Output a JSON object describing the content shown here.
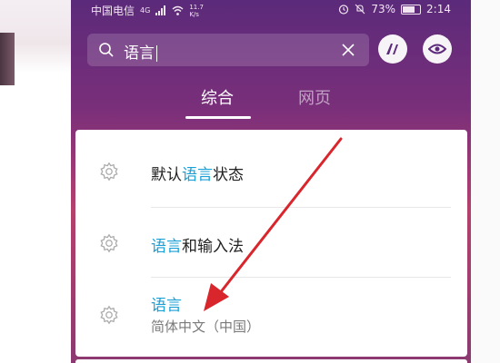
{
  "status_bar": {
    "carrier": "中国电信",
    "network": "4G",
    "speed_value": "11.7",
    "speed_unit": "K/s",
    "battery": "73%",
    "time": "2:14"
  },
  "search": {
    "query": "语言"
  },
  "tabs": [
    {
      "label": "综合",
      "active": true
    },
    {
      "label": "网页",
      "active": false
    }
  ],
  "results": [
    {
      "title_before": "默认",
      "title_highlight": "语言",
      "title_after": "状态",
      "subtitle": ""
    },
    {
      "title_before": "",
      "title_highlight": "语言",
      "title_after": "和输入法",
      "subtitle": ""
    },
    {
      "title_before": "",
      "title_highlight": "语言",
      "title_after": "",
      "subtitle": "简体中文（中国）"
    }
  ],
  "colors": {
    "highlight": "#1a9fd6",
    "arrow": "#d9262c"
  },
  "icons": {
    "search": "search-icon",
    "clear": "close-icon",
    "voice_button": "ai-voice-icon",
    "lens_button": "lens-icon",
    "result": "gear-icon"
  }
}
